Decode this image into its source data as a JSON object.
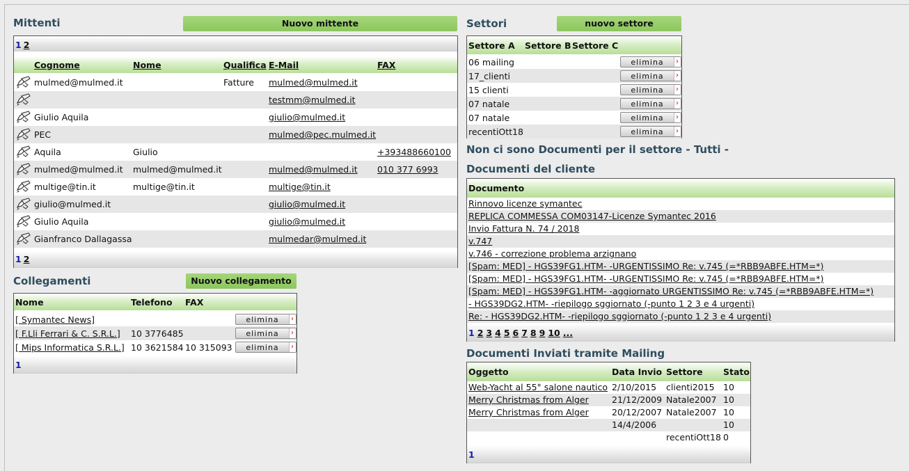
{
  "mittenti": {
    "title": "Mittenti",
    "new_button": "Nuovo mittente",
    "pager": [
      "1",
      "2"
    ],
    "columns": [
      "Cognome",
      "Nome",
      "Qualifica",
      "E-Mail",
      "FAX"
    ],
    "rows": [
      {
        "cognome": "mulmed@mulmed.it",
        "nome": "",
        "qualifica": "Fatture",
        "email": "mulmed@mulmed.it",
        "fax": ""
      },
      {
        "cognome": "",
        "nome": "",
        "qualifica": "",
        "email": "testmm@mulmed.it",
        "fax": ""
      },
      {
        "cognome": "Giulio Aquila",
        "nome": "",
        "qualifica": "",
        "email": "giulio@mulmed.it",
        "fax": ""
      },
      {
        "cognome": "PEC",
        "nome": "",
        "qualifica": "",
        "email": "mulmed@pec.mulmed.it",
        "fax": ""
      },
      {
        "cognome": "Aquila",
        "nome": "Giulio",
        "qualifica": "",
        "email": "",
        "fax": "+393488660100"
      },
      {
        "cognome": "mulmed@mulmed.it",
        "nome": "mulmed@mulmed.it",
        "qualifica": "",
        "email": "mulmed@mulmed.it",
        "fax": "010 377 6993"
      },
      {
        "cognome": "multige@tin.it",
        "nome": "multige@tin.it",
        "qualifica": "",
        "email": "multige@tin.it",
        "fax": ""
      },
      {
        "cognome": "giulio@mulmed.it",
        "nome": "",
        "qualifica": "",
        "email": "giulio@mulmed.it",
        "fax": ""
      },
      {
        "cognome": "Giulio Aquila",
        "nome": "",
        "qualifica": "",
        "email": "giulio@mulmed.it",
        "fax": ""
      },
      {
        "cognome": "Gianfranco Dallagassa",
        "nome": "",
        "qualifica": "",
        "email": "mulmedar@mulmed.it",
        "fax": ""
      }
    ]
  },
  "collegamenti": {
    "title": "Collegamenti",
    "new_button": "Nuovo collegamento",
    "columns": [
      "Nome",
      "Telefono",
      "FAX"
    ],
    "rows": [
      {
        "nome": "[ Symantec News]",
        "telefono": "",
        "fax": "",
        "action": "elimina"
      },
      {
        "nome": "[ F.Lli Ferrari & C. S.R.L.]",
        "telefono": "10 3776485",
        "fax": "",
        "action": "elimina"
      },
      {
        "nome": "[ Mips Informatica S.R.L.]",
        "telefono": "10 3621584",
        "fax": "10 315093",
        "action": "elimina"
      }
    ],
    "pager": [
      "1"
    ]
  },
  "settori": {
    "title": "Settori",
    "new_button": "nuovo settore",
    "columns": [
      "Settore A",
      "Settore B",
      "Settore C"
    ],
    "rows": [
      "06 mailing",
      "17_clienti",
      "15 clienti",
      "07 natale",
      "07 natale",
      "recentiOtt18"
    ],
    "action": "elimina"
  },
  "no_docs_message": "Non ci sono Documenti per il settore - Tutti -",
  "documenti_cliente": {
    "title": "Documenti del cliente",
    "column": "Documento",
    "rows": [
      "Rinnovo licenze symantec",
      "REPLICA COMMESSA COM03147-Licenze Symantec 2016",
      "Invio Fattura N. 74 / 2018",
      "v.747",
      "v.746 - correzione problema arzignano",
      "[Spam: MED] -  HGS39FG1.HTM-  -URGENTISSIMO Re: v.745 (=*RBB9ABFE.HTM=*)",
      "[Spam: MED] -  HGS39FG1.HTM-  -URGENTISSIMO Re: v.745 (=*RBB9ABFE.HTM=*)",
      "[Spam: MED] -  HGS39FG1.HTM-  -aggiornato URGENTISSIMO Re: v.745 (=*RBB9ABFE.HTM=*)",
      "-  HGS39DG2.HTM-  -riepilogo sggiornato (-punto 1 2 3 e 4 urgenti)",
      "Re: -  HGS39DG2.HTM-  -riepilogo sggiornato (-punto 1 2 3 e 4 urgenti)"
    ],
    "pager": [
      "1",
      "2",
      "3",
      "4",
      "5",
      "6",
      "7",
      "8",
      "9",
      "10",
      "..."
    ]
  },
  "mailing": {
    "title": "Documenti Inviati tramite Mailing",
    "columns": [
      "Oggetto",
      "Data Invio",
      "Settore",
      "Stato"
    ],
    "rows": [
      {
        "oggetto": "Web-Yacht al 55° salone nautico",
        "data": "2/10/2015",
        "settore": "clienti2015",
        "stato": "10"
      },
      {
        "oggetto": "Merry Christmas from Alger",
        "data": "21/12/2009",
        "settore": "Natale2007",
        "stato": "10"
      },
      {
        "oggetto": "Merry Christmas from Alger",
        "data": "20/12/2007",
        "settore": "Natale2007",
        "stato": "10"
      },
      {
        "oggetto": "",
        "data": "14/4/2006",
        "settore": "",
        "stato": "10"
      },
      {
        "oggetto": "",
        "data": "",
        "settore": "recentiOtt18",
        "stato": "0"
      }
    ],
    "pager": [
      "1"
    ]
  },
  "icons": {
    "edit": "pencil-edit-icon",
    "delete_arrow": "chevron-right-icon"
  },
  "colors": {
    "accent_green": "#8cc65e",
    "title": "#2f4d5f",
    "pager_current": "#1a1aa6"
  }
}
